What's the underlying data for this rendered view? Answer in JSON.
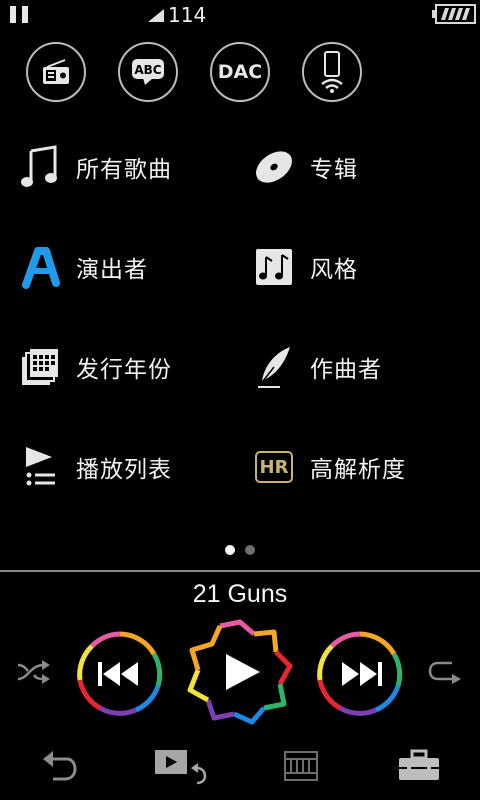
{
  "status": {
    "signal_text": "114"
  },
  "quick_icons": [
    {
      "name": "radio",
      "icon": "radio-icon"
    },
    {
      "name": "abc",
      "label": "ABC",
      "icon": "abc-speech-icon"
    },
    {
      "name": "dac",
      "label": "DAC"
    },
    {
      "name": "phone-wireless",
      "icon": "phone-wireless-icon"
    }
  ],
  "menu": {
    "all_songs": "所有歌曲",
    "albums": "专辑",
    "artists": "演出者",
    "genres": "风格",
    "release_year": "发行年份",
    "composers": "作曲者",
    "playlists": "播放列表",
    "hi_res": "高解析度",
    "hi_res_badge": "HR"
  },
  "player": {
    "track_title": "21 Guns"
  },
  "colors": {
    "accent_blue": "#1e9bea",
    "hr_gold": "#c9b27a",
    "ring_colors": [
      "#e8262f",
      "#f5a623",
      "#f4e23b",
      "#2fb36b",
      "#1e88e5",
      "#7b3fb4",
      "#e85aa3"
    ]
  }
}
